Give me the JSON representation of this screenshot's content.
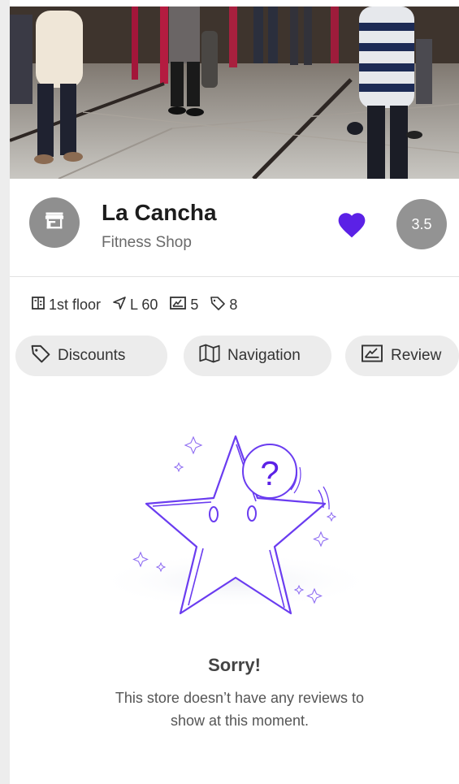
{
  "store": {
    "name": "La Cancha",
    "category": "Fitness Shop",
    "rating": "3.5",
    "favorited": true
  },
  "meta": {
    "floor": "1st floor",
    "location": "L 60",
    "reviews_count": "5",
    "discounts_count": "8"
  },
  "tabs": [
    {
      "label": "Discounts",
      "icon": "tag-icon"
    },
    {
      "label": "Navigation",
      "icon": "map-icon"
    },
    {
      "label": "Review",
      "icon": "review-icon"
    }
  ],
  "empty_state": {
    "title": "Sorry!",
    "message": "This store doesn’t have any reviews to show at this moment."
  },
  "colors": {
    "accent": "#5b21e6",
    "avatar_gray": "#8f8f8f",
    "chip_bg": "#ececec"
  }
}
